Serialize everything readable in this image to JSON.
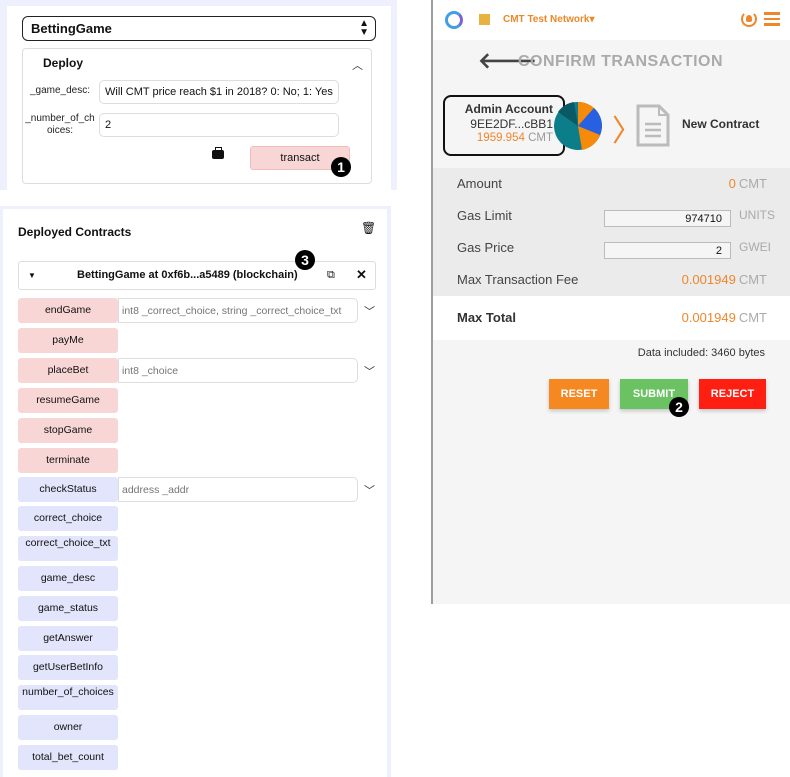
{
  "deploy": {
    "selected_contract": "BettingGame",
    "section_title": "Deploy",
    "params": [
      {
        "label": "_game_desc:",
        "value": "Will CMT price reach $1 in 2018? 0: No; 1: Yes"
      },
      {
        "label": "_number_of_ch oices:",
        "value": "2"
      }
    ],
    "transact_label": "transact",
    "step_badge": "1"
  },
  "deployed": {
    "title": "Deployed Contracts",
    "instance_name": "BettingGame at 0xf6b...a5489 (blockchain)",
    "step_badge": "3",
    "functions": [
      {
        "name": "endGame",
        "kind": "tx",
        "placeholder": "int8 _correct_choice, string _correct_choice_txt"
      },
      {
        "name": "payMe",
        "kind": "tx"
      },
      {
        "name": "placeBet",
        "kind": "tx",
        "placeholder": "int8 _choice"
      },
      {
        "name": "resumeGame",
        "kind": "tx"
      },
      {
        "name": "stopGame",
        "kind": "tx"
      },
      {
        "name": "terminate",
        "kind": "tx"
      },
      {
        "name": "checkStatus",
        "kind": "call",
        "placeholder": "address _addr"
      },
      {
        "name": "correct_choice",
        "kind": "call"
      },
      {
        "name": "correct_choice_txt",
        "kind": "call"
      },
      {
        "name": "game_desc",
        "kind": "call"
      },
      {
        "name": "game_status",
        "kind": "call"
      },
      {
        "name": "getAnswer",
        "kind": "call"
      },
      {
        "name": "getUserBetInfo",
        "kind": "call"
      },
      {
        "name": "number_of_choices",
        "kind": "call"
      },
      {
        "name": "owner",
        "kind": "call"
      },
      {
        "name": "total_bet_count",
        "kind": "call"
      }
    ]
  },
  "wallet": {
    "network": "CMT Test Network",
    "network_color": "#e8b23f",
    "title": "CONFIRM TRANSACTION",
    "account": {
      "name": "Admin Account",
      "address": "9EE2DF...cBB1",
      "balance": "1959.954",
      "unit": "CMT"
    },
    "recipient": "New Contract",
    "amount": {
      "label": "Amount",
      "value": "0",
      "unit": "CMT"
    },
    "gas_limit": {
      "label": "Gas Limit",
      "value": "974710",
      "unit": "UNITS"
    },
    "gas_price": {
      "label": "Gas Price",
      "value": "2",
      "unit": "GWEI"
    },
    "max_fee": {
      "label": "Max Transaction Fee",
      "value": "0.001949",
      "unit": "CMT"
    },
    "max_total": {
      "label": "Max Total",
      "value": "0.001949",
      "unit": "CMT"
    },
    "data_included": "Data included: 3460 bytes",
    "buttons": {
      "reset": "RESET",
      "submit": "SUBMIT",
      "reject": "REJECT"
    },
    "step_badge": "2",
    "accent_color": "#f0862a"
  }
}
